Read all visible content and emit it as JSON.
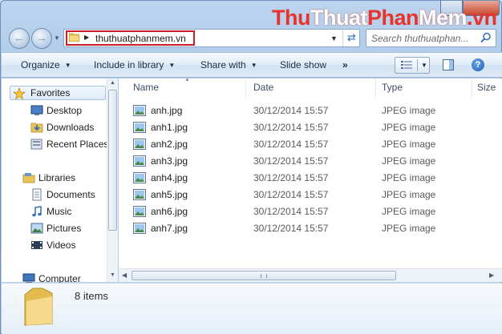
{
  "watermark": {
    "part1": "Thu",
    "part2": "Thuat",
    "part3": "Phan",
    "part4": "Mem",
    "part5": ".vn"
  },
  "address": {
    "folder": "thuthuatphanmem.vn"
  },
  "search": {
    "placeholder": "Search thuthuatphan..."
  },
  "toolbar": {
    "organize": "Organize",
    "include": "Include in library",
    "share": "Share with",
    "slideshow": "Slide show",
    "more": "»"
  },
  "navpane": {
    "items": [
      {
        "label": "Favorites",
        "icon": "star-icon"
      },
      {
        "label": "Desktop",
        "icon": "desktop-icon"
      },
      {
        "label": "Downloads",
        "icon": "downloads-icon"
      },
      {
        "label": "Recent Places",
        "icon": "recent-places-icon"
      },
      {
        "label": "Libraries",
        "icon": "libraries-icon"
      },
      {
        "label": "Documents",
        "icon": "documents-icon"
      },
      {
        "label": "Music",
        "icon": "music-icon"
      },
      {
        "label": "Pictures",
        "icon": "pictures-icon"
      },
      {
        "label": "Videos",
        "icon": "videos-icon"
      },
      {
        "label": "Computer",
        "icon": "computer-icon"
      }
    ]
  },
  "columns": {
    "name": "Name",
    "date": "Date",
    "type": "Type",
    "size": "Size"
  },
  "files": [
    {
      "name": "anh.jpg",
      "date": "30/12/2014 15:57",
      "type": "JPEG image"
    },
    {
      "name": "anh1.jpg",
      "date": "30/12/2014 15:57",
      "type": "JPEG image"
    },
    {
      "name": "anh2.jpg",
      "date": "30/12/2014 15:57",
      "type": "JPEG image"
    },
    {
      "name": "anh3.jpg",
      "date": "30/12/2014 15:57",
      "type": "JPEG image"
    },
    {
      "name": "anh4.jpg",
      "date": "30/12/2014 15:57",
      "type": "JPEG image"
    },
    {
      "name": "anh5.jpg",
      "date": "30/12/2014 15:57",
      "type": "JPEG image"
    },
    {
      "name": "anh6.jpg",
      "date": "30/12/2014 15:57",
      "type": "JPEG image"
    },
    {
      "name": "anh7.jpg",
      "date": "30/12/2014 15:57",
      "type": "JPEG image"
    }
  ],
  "details": {
    "count": "8 items"
  },
  "colors": {
    "highlight_border": "#c7202b",
    "accent": "#2f6fb3"
  }
}
